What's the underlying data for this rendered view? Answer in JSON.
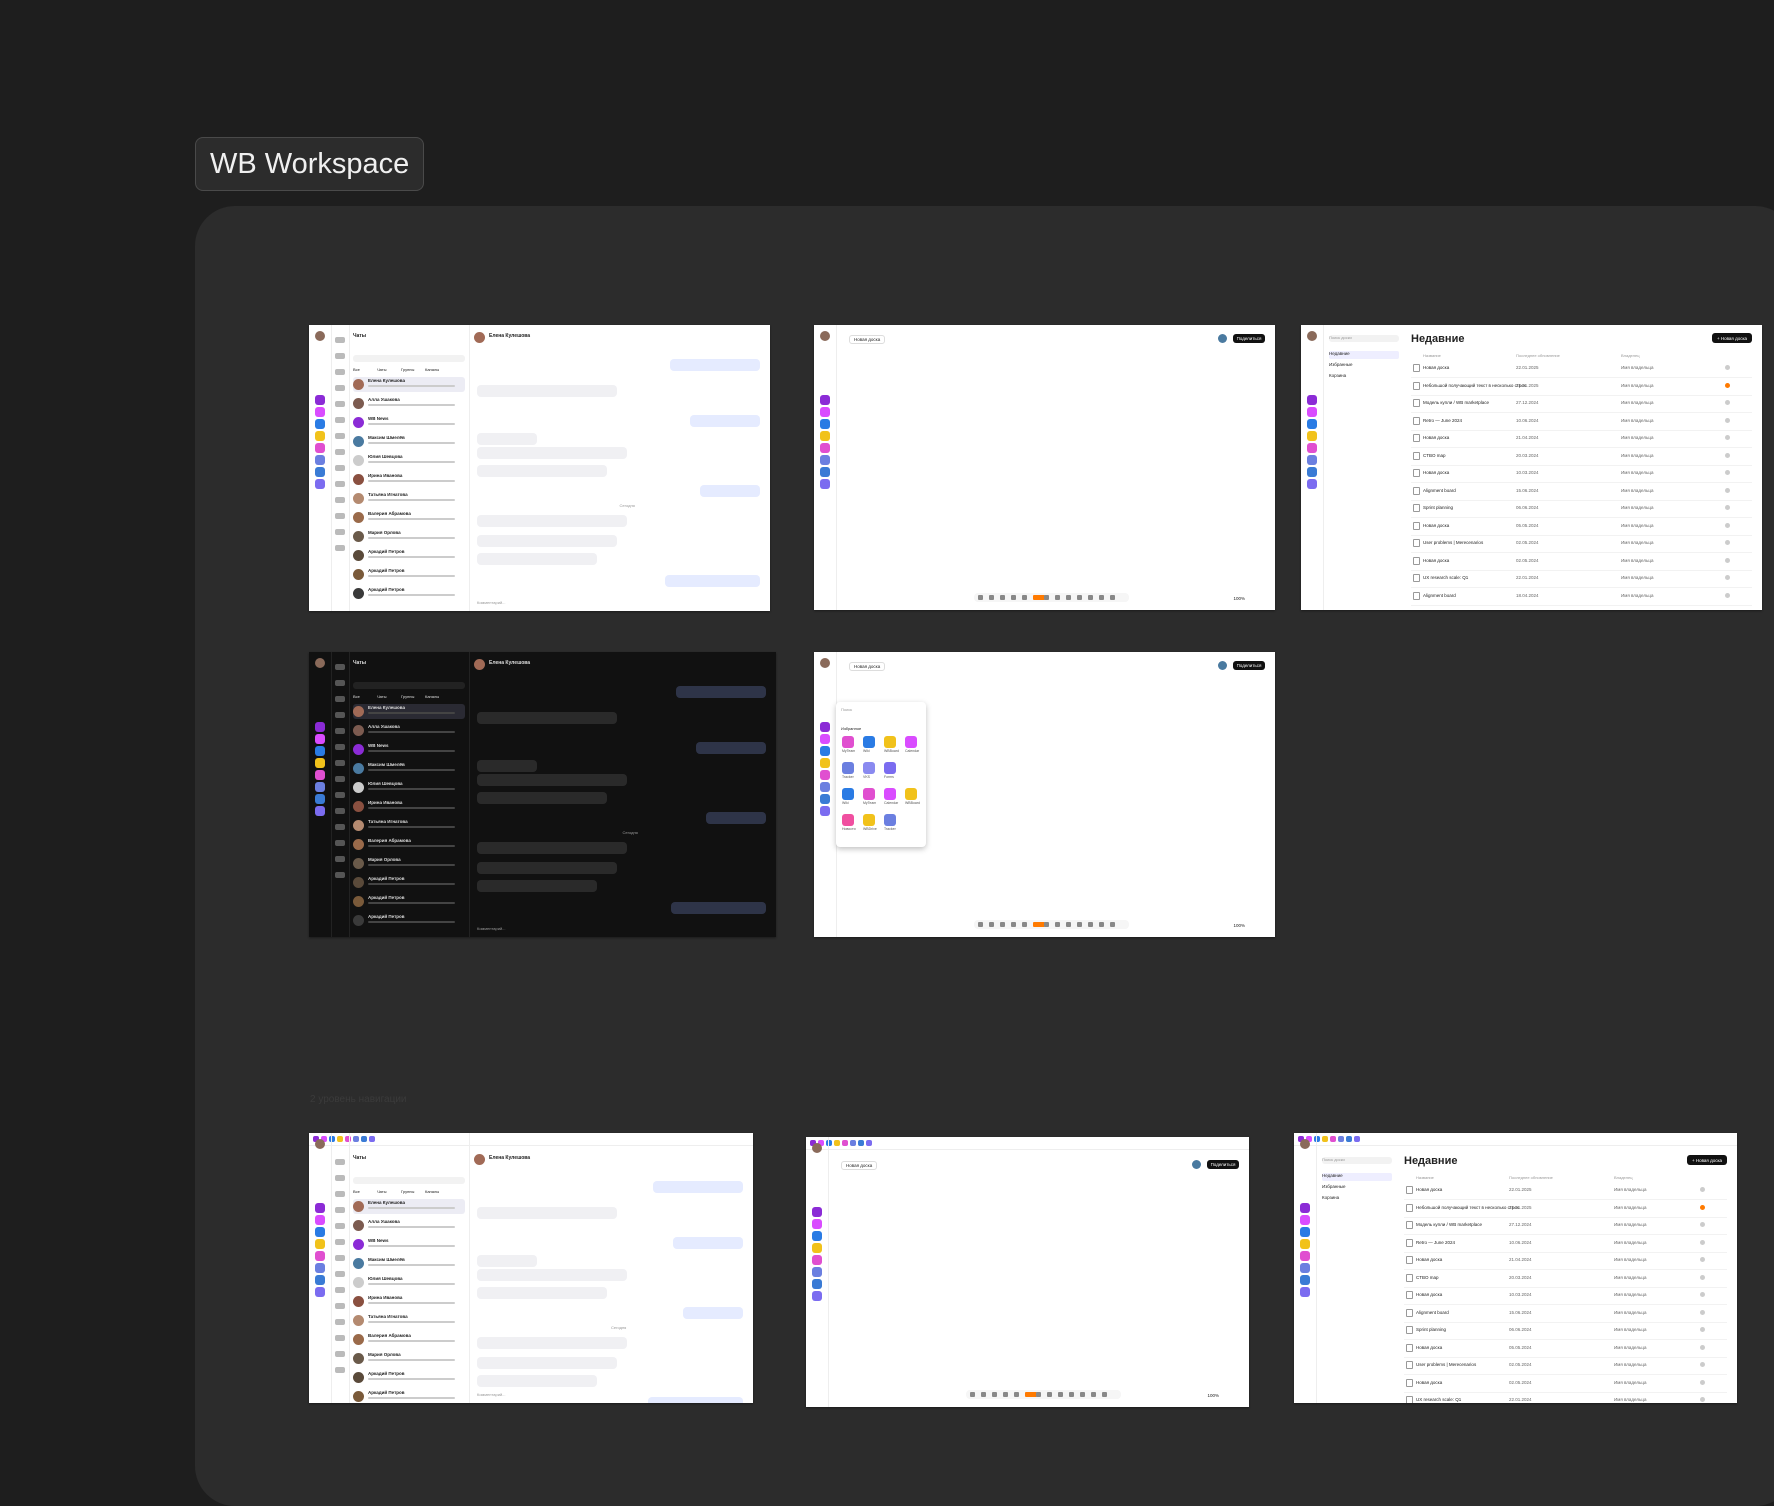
{
  "workspace": {
    "title": "WB Workspace"
  },
  "section_label": "2 уровень навигации",
  "chat": {
    "header": "Чаты",
    "contact_name": "Елена Кулешова",
    "tabs": [
      "Все",
      "Чаты",
      "Группы",
      "Каналы"
    ],
    "rows": [
      {
        "name": "Елена Кулешова",
        "color": "#a16a56"
      },
      {
        "name": "Алла Ушакова",
        "color": "#7c5b50"
      },
      {
        "name": "WB News",
        "color": "#8b2bd6"
      },
      {
        "name": "Максим Шмелёв",
        "color": "#4a7aa0"
      },
      {
        "name": "Юлия Шевцова",
        "color": "#ccc"
      },
      {
        "name": "Ирина Иванова",
        "color": "#8a5040"
      },
      {
        "name": "Татьяна Игнатова",
        "color": "#b48a70"
      },
      {
        "name": "Валерия Абрамова",
        "color": "#9a6a4a"
      },
      {
        "name": "Мария Орлова",
        "color": "#6a5a4a"
      },
      {
        "name": "Аркадий Петров",
        "color": "#5a4a3a"
      },
      {
        "name": "Аркадий Петров",
        "color": "#7a5a3a"
      },
      {
        "name": "Аркадий Петров",
        "color": "#3a3a3a"
      }
    ],
    "separator": "Сегодня",
    "compose_placeholder": "Комментарий..."
  },
  "board": {
    "title": "Новая доска",
    "share": "Поделиться",
    "zoom": "100%",
    "popup": {
      "search": "Поиск",
      "section": "Избранное",
      "apps": [
        {
          "label": "MyTeam",
          "color": "#e04fd0"
        },
        {
          "label": "Wiki",
          "color": "#2a7be4"
        },
        {
          "label": "WBBoard",
          "color": "#f1c21b"
        },
        {
          "label": "Calendar",
          "color": "#d94cff"
        },
        {
          "label": "Tracker",
          "color": "#6b7fe0"
        },
        {
          "label": "VKS",
          "color": "#8a8af0"
        },
        {
          "label": "Forms",
          "color": "#7b6cf0"
        },
        {
          "label": "",
          "color": "#ffffff"
        },
        {
          "label": "Wiki",
          "color": "#2a7be4"
        },
        {
          "label": "MyTeam",
          "color": "#e04fd0"
        },
        {
          "label": "Calendar",
          "color": "#d94cff"
        },
        {
          "label": "WBBoard",
          "color": "#f1c21b"
        },
        {
          "label": "Новости",
          "color": "#f04fa0"
        },
        {
          "label": "WBDrive",
          "color": "#f1c21b"
        },
        {
          "label": "Tracker",
          "color": "#6b7fe0"
        }
      ]
    }
  },
  "recent": {
    "search": "Поиск доски",
    "heading": "Недавние",
    "new_button": "+ Новая доска",
    "nav": [
      "Недавние",
      "Избранные",
      "Корзина"
    ],
    "columns": [
      "Название",
      "Последнее обновление",
      "Владелец"
    ],
    "rows": [
      {
        "name": "Новая доска",
        "date": "22.01.2025",
        "owner": "Имя владельца",
        "starred": false
      },
      {
        "name": "Небольшой получающий текст в несколько строк",
        "date": "21.01.2025",
        "owner": "Имя владельца",
        "starred": true
      },
      {
        "name": "Модель купли / WB marketplace",
        "date": "27.12.2024",
        "owner": "Имя владельца",
        "starred": false
      },
      {
        "name": "Retro — June 2024",
        "date": "10.06.2024",
        "owner": "Имя владельца",
        "starred": false
      },
      {
        "name": "Новая доска",
        "date": "21.04.2024",
        "owner": "Имя владельца",
        "starred": false
      },
      {
        "name": "CTBO map",
        "date": "20.03.2024",
        "owner": "Имя владельца",
        "starred": false
      },
      {
        "name": "Новая доска",
        "date": "10.03.2024",
        "owner": "Имя владельца",
        "starred": false
      },
      {
        "name": "Alignment board",
        "date": "15.06.2024",
        "owner": "Имя владельца",
        "starred": false
      },
      {
        "name": "Sprint planning",
        "date": "06.06.2024",
        "owner": "Имя владельца",
        "starred": false
      },
      {
        "name": "Новая доска",
        "date": "05.05.2024",
        "owner": "Имя владельца",
        "starred": false
      },
      {
        "name": "User problems | Merecenarios",
        "date": "02.05.2024",
        "owner": "Имя владельца",
        "starred": false
      },
      {
        "name": "Новая доска",
        "date": "02.05.2024",
        "owner": "Имя владельца",
        "starred": false
      },
      {
        "name": "UX research scale: Q1",
        "date": "22.01.2024",
        "owner": "Имя владельца",
        "starred": false
      },
      {
        "name": "Alignment board",
        "date": "18.04.2024",
        "owner": "Имя владельца",
        "starred": false
      }
    ]
  },
  "app_colors": [
    "#8b2bd6",
    "#d94cff",
    "#2a7be4",
    "#f1c21b",
    "#e04fd0",
    "#6b7fe0",
    "#3a7bd5",
    "#7b6cf0"
  ]
}
